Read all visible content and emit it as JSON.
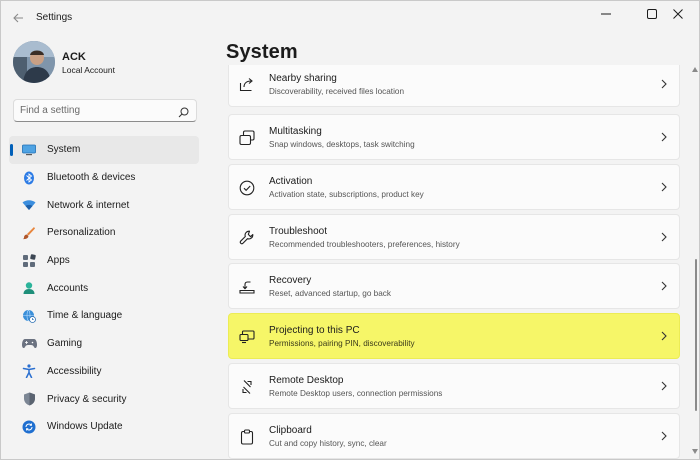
{
  "window": {
    "title": "Settings"
  },
  "profile": {
    "name": "ACK",
    "account_type": "Local Account"
  },
  "search": {
    "placeholder": "Find a setting"
  },
  "nav": {
    "items": [
      {
        "label": "System",
        "icon": "system-icon",
        "selected": true
      },
      {
        "label": "Bluetooth & devices",
        "icon": "bluetooth-icon"
      },
      {
        "label": "Network & internet",
        "icon": "wifi-icon"
      },
      {
        "label": "Personalization",
        "icon": "brush-icon"
      },
      {
        "label": "Apps",
        "icon": "apps-icon"
      },
      {
        "label": "Accounts",
        "icon": "accounts-icon"
      },
      {
        "label": "Time & language",
        "icon": "globe-clock-icon"
      },
      {
        "label": "Gaming",
        "icon": "gamepad-icon"
      },
      {
        "label": "Accessibility",
        "icon": "accessibility-icon"
      },
      {
        "label": "Privacy & security",
        "icon": "shield-icon"
      },
      {
        "label": "Windows Update",
        "icon": "update-icon"
      }
    ]
  },
  "main": {
    "title": "System",
    "cards": [
      {
        "title": "Nearby sharing",
        "subtitle": "Discoverability, received files location",
        "icon": "share-icon"
      },
      {
        "title": "Multitasking",
        "subtitle": "Snap windows, desktops, task switching",
        "icon": "multitasking-icon"
      },
      {
        "title": "Activation",
        "subtitle": "Activation state, subscriptions, product key",
        "icon": "check-circle-icon"
      },
      {
        "title": "Troubleshoot",
        "subtitle": "Recommended troubleshooters, preferences, history",
        "icon": "wrench-icon"
      },
      {
        "title": "Recovery",
        "subtitle": "Reset, advanced startup, go back",
        "icon": "recovery-icon"
      },
      {
        "title": "Projecting to this PC",
        "subtitle": "Permissions, pairing PIN, discoverability",
        "icon": "projecting-icon",
        "highlighted": true
      },
      {
        "title": "Remote Desktop",
        "subtitle": "Remote Desktop users, connection permissions",
        "icon": "remote-desktop-icon"
      },
      {
        "title": "Clipboard",
        "subtitle": "Cut and copy history, sync, clear",
        "icon": "clipboard-icon"
      }
    ]
  },
  "colors": {
    "accent": "#005fb8",
    "highlight": "#f6f668"
  }
}
